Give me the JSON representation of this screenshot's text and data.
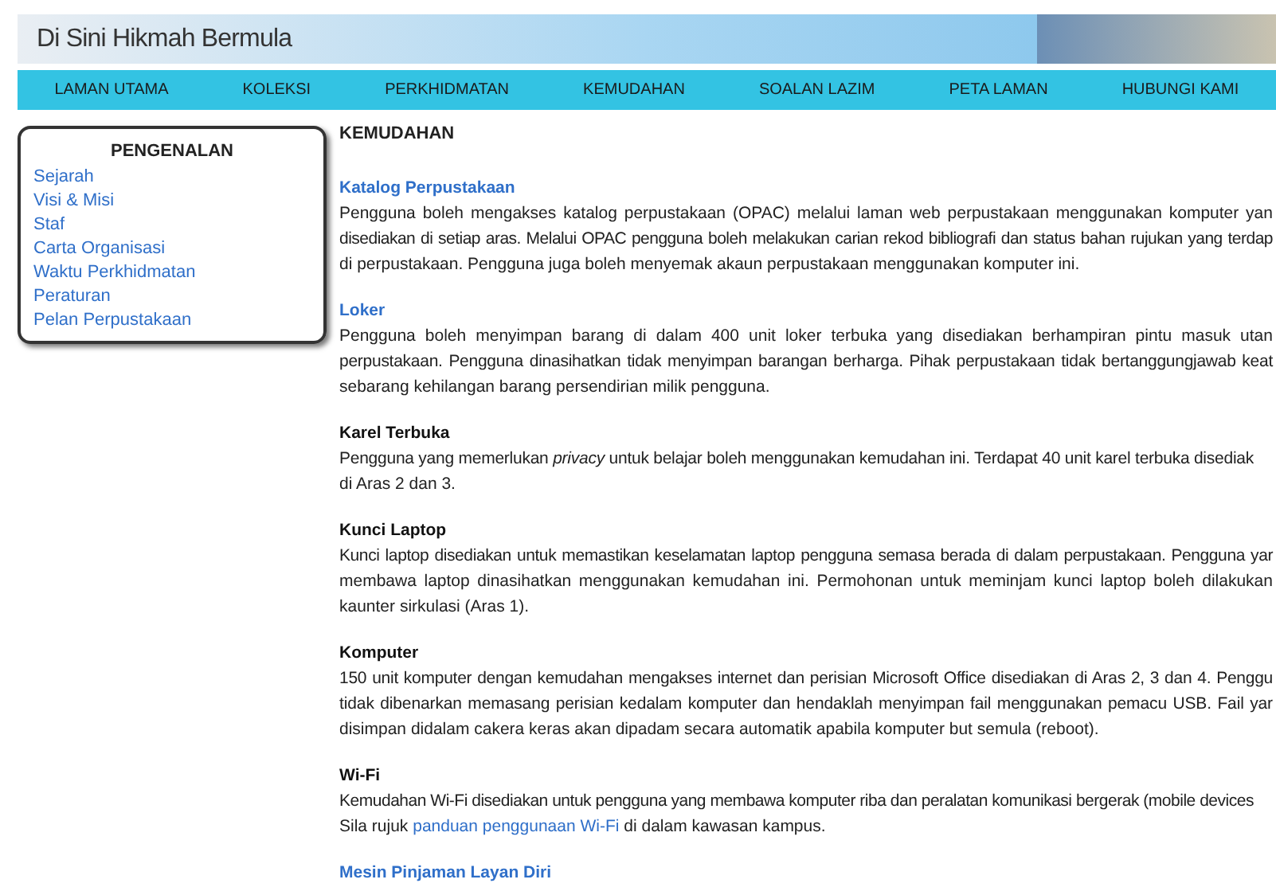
{
  "banner": {
    "tagline": "Di Sini Hikmah Bermula"
  },
  "nav": [
    {
      "label": "LAMAN UTAMA"
    },
    {
      "label": "KOLEKSI"
    },
    {
      "label": "PERKHIDMATAN"
    },
    {
      "label": "KEMUDAHAN"
    },
    {
      "label": "SOALAN LAZIM"
    },
    {
      "label": "PETA LAMAN"
    },
    {
      "label": "HUBUNGI KAMI"
    }
  ],
  "sidebar": {
    "title": "PENGENALAN",
    "items": [
      {
        "label": "Sejarah"
      },
      {
        "label": "Visi & Misi"
      },
      {
        "label": "Staf"
      },
      {
        "label": "Carta Organisasi"
      },
      {
        "label": "Waktu Perkhidmatan"
      },
      {
        "label": "Peraturan"
      },
      {
        "label": "Pelan Perpustakaan"
      }
    ]
  },
  "page_title": "KEMUDAHAN",
  "sections": [
    {
      "heading": "Katalog Perpustakaan",
      "kind": "link",
      "lines": [
        {
          "text": "Pengguna boleh mengakses katalog perpustakaan (OPAC) melalui laman web perpustakaan menggunakan komputer yan",
          "justified": true
        },
        {
          "text": "disediakan di setiap aras. Melalui OPAC pengguna boleh melakukan carian rekod bibliografi dan status bahan rujukan yang terdap",
          "justified": true
        },
        {
          "text": "di perpustakaan. Pengguna juga boleh menyemak akaun perpustakaan menggunakan komputer ini.",
          "justified": false
        }
      ]
    },
    {
      "heading": "Loker",
      "kind": "link",
      "lines": [
        {
          "text": "Pengguna boleh menyimpan barang di dalam 400 unit loker terbuka yang disediakan berhampiran pintu masuk utan",
          "justified": true
        },
        {
          "text": "perpustakaan. Pengguna dinasihatkan tidak menyimpan barangan berharga. Pihak perpustakaan tidak bertanggungjawab keat",
          "justified": true
        },
        {
          "text": "sebarang kehilangan barang persendirian milik pengguna.",
          "justified": false
        }
      ]
    },
    {
      "heading": "Karel Terbuka",
      "kind": "plain",
      "lines": [
        {
          "text": "Pengguna yang memerlukan *privacy* untuk belajar boleh menggunakan kemudahan ini. Terdapat 40 unit karel terbuka disediak",
          "justified": false
        },
        {
          "text": "di Aras 2 dan 3.",
          "justified": false
        }
      ]
    },
    {
      "heading": "Kunci Laptop",
      "kind": "plain",
      "lines": [
        {
          "text": "Kunci laptop disediakan untuk memastikan keselamatan laptop pengguna semasa berada di dalam perpustakaan. Pengguna yar",
          "justified": true
        },
        {
          "text": "membawa laptop dinasihatkan menggunakan kemudahan ini. Permohonan untuk meminjam kunci laptop boleh dilakukan",
          "justified": true
        },
        {
          "text": "kaunter sirkulasi (Aras 1).",
          "justified": false
        }
      ]
    },
    {
      "heading": "Komputer",
      "kind": "plain",
      "lines": [
        {
          "text": "150 unit komputer dengan kemudahan mengakses internet dan perisian Microsoft Office disediakan di Aras 2, 3 dan 4. Penggu",
          "justified": true
        },
        {
          "text": "tidak dibenarkan memasang perisian kedalam komputer dan hendaklah menyimpan fail menggunakan pemacu USB. Fail yar",
          "justified": true
        },
        {
          "text": "disimpan didalam cakera keras akan dipadam secara automatik apabila komputer but semula (reboot).",
          "justified": false
        }
      ]
    },
    {
      "heading": "Wi-Fi",
      "kind": "plain",
      "lines": [
        {
          "text": "Kemudahan Wi-Fi disediakan untuk pengguna yang membawa komputer riba dan peralatan komunikasi bergerak (mobile devices",
          "justified": false
        },
        {
          "before": "Sila rujuk ",
          "link": "panduan penggunaan Wi-Fi",
          "after": " di dalam kawasan kampus.",
          "justified": false
        }
      ]
    },
    {
      "heading": "Mesin Pinjaman Layan Diri",
      "kind": "link"
    }
  ]
}
